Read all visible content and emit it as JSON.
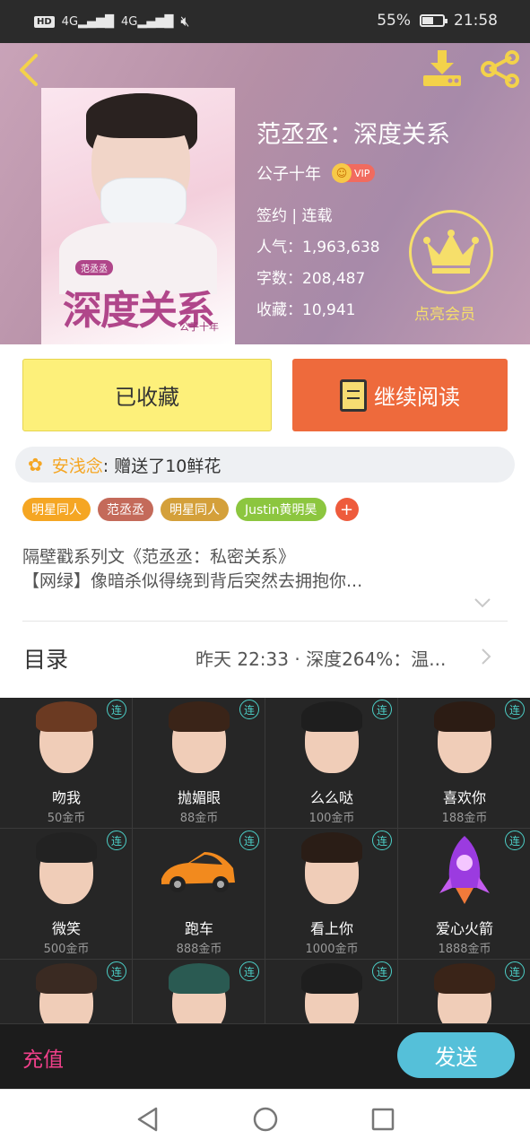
{
  "status_bar": {
    "hd": "HD",
    "signal1": "4G",
    "signal2": "4G",
    "battery_percent": "55%",
    "battery_level": 0.55,
    "time": "21:58"
  },
  "header": {
    "cover": {
      "series_tag": "范丞丞",
      "title": "深度关系",
      "author_mark": "公子十年"
    },
    "book_title": "范丞丞：深度关系",
    "author": "公子十年",
    "vip_label": "VIP",
    "status": "签约 | 连载",
    "popularity_label": "人气：",
    "popularity_value": "1,963,638",
    "words_label": "字数：",
    "words_value": "208,487",
    "favorites_label": "收藏：",
    "favorites_value": "10,941",
    "member_label": "点亮会员"
  },
  "actions": {
    "favorited_label": "已收藏",
    "continue_label": "继续阅读"
  },
  "gift_ticker": {
    "user": "安浅念",
    "message": ": 赠送了10鲜花"
  },
  "tags": [
    {
      "label": "明星同人",
      "color": "#f5a623"
    },
    {
      "label": "范丞丞",
      "color": "#c46a5a"
    },
    {
      "label": "明星同人",
      "color": "#d4a03a"
    },
    {
      "label": "Justin黄明昊",
      "color": "#8cc63f"
    }
  ],
  "tag_more": "+",
  "intro": {
    "line1": "隔壁戳系列文《范丞丞：私密关系》",
    "line2": "【网绿】像暗杀似得绕到背后突然去拥抱你..."
  },
  "toc": {
    "title": "目录",
    "latest": "昨天 22:33 · 深度264%：温..."
  },
  "gifts": [
    {
      "name": "吻我",
      "price": "50金币",
      "badge": "连"
    },
    {
      "name": "抛媚眼",
      "price": "88金币",
      "badge": "连"
    },
    {
      "name": "么么哒",
      "price": "100金币",
      "badge": "连"
    },
    {
      "name": "喜欢你",
      "price": "188金币",
      "badge": "连"
    },
    {
      "name": "微笑",
      "price": "500金币",
      "badge": "连"
    },
    {
      "name": "跑车",
      "price": "888金币",
      "badge": "连"
    },
    {
      "name": "看上你",
      "price": "1000金币",
      "badge": "连"
    },
    {
      "name": "爱心火箭",
      "price": "1888金币",
      "badge": "连"
    },
    {
      "name": "",
      "price": "",
      "badge": "连"
    },
    {
      "name": "",
      "price": "",
      "badge": "连"
    },
    {
      "name": "",
      "price": "",
      "badge": "连"
    },
    {
      "name": "",
      "price": "",
      "badge": "连"
    }
  ],
  "gift_footer": {
    "recharge_label": "充值",
    "send_label": "发送"
  },
  "colors": {
    "accent_yellow": "#fdf07a",
    "accent_orange": "#ee6a3c",
    "send_blue": "#55c0d9",
    "recharge_pink": "#f0408a"
  }
}
